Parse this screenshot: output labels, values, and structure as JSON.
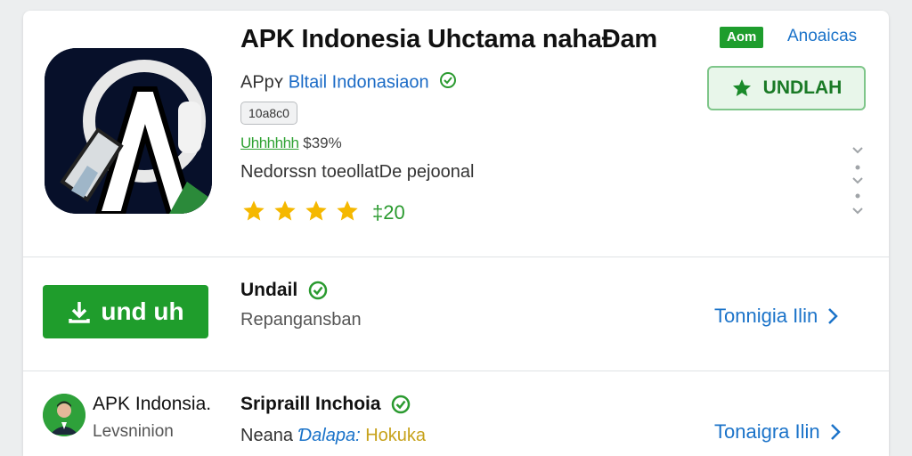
{
  "app": {
    "title": "APK Indonesia Uhctama nahaĐam",
    "badge": "Aom",
    "category_link": "Anoaicas",
    "developer_prefix": "APpʏ",
    "developer_name": "Bltail Indonasiaon",
    "size_chip": "10a8c0",
    "stats_green": "Uhhhhhh",
    "stats_value": "$39%",
    "description": "Nedorssn toeollatDe pejoonal",
    "rating": {
      "stars": 4,
      "max": 5,
      "count_text": "‡20"
    },
    "download_label": "UNDLAH"
  },
  "rows": [
    {
      "button_label": "und uh",
      "title": "Undail",
      "subtitle": "Repangansban",
      "link": "Tonnigia Ilin"
    },
    {
      "name_title": "APK Indonsia.",
      "name_sub": "Levsninion",
      "title": "Sripraill Inchoia",
      "sub_a": "Neana ",
      "sub_b": "Ɗalapa: ",
      "sub_c": "Hokuka",
      "link": "Tonaigra Ilin"
    }
  ],
  "colors": {
    "accent_green": "#1f9d2c",
    "link_blue": "#1b73c9",
    "star_yellow": "#f5b800"
  },
  "icons": [
    "app-logo-icon",
    "verified-check-icon",
    "star-icon",
    "download-arrow-icon",
    "chevron-right-icon",
    "more-chevrons-icon",
    "avatar-icon"
  ]
}
